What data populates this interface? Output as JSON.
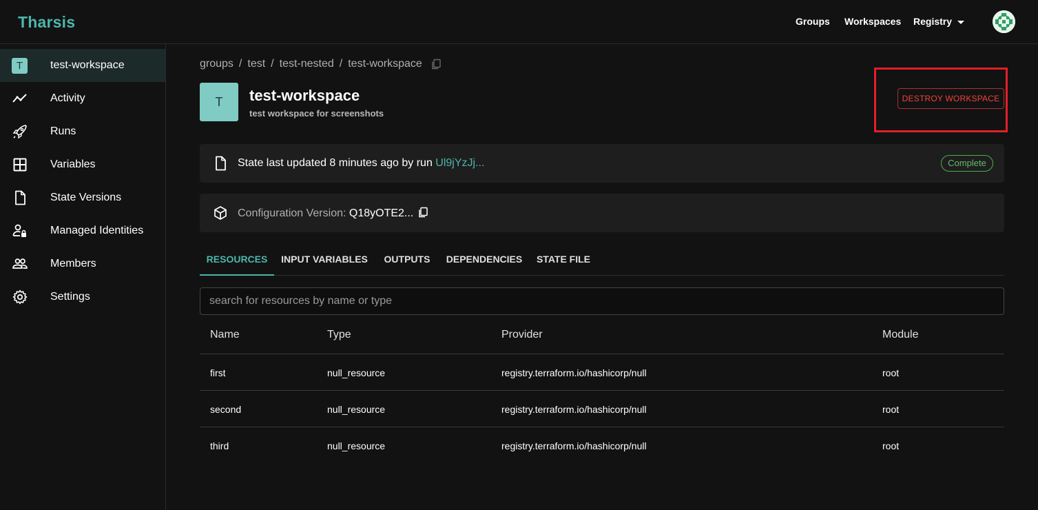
{
  "app": {
    "brand": "Tharsis"
  },
  "nav": {
    "groups": "Groups",
    "workspaces": "Workspaces",
    "registry": "Registry"
  },
  "sidebar": {
    "badge": "T",
    "items": [
      {
        "label": "test-workspace",
        "icon": "workspace-badge"
      },
      {
        "label": "Activity",
        "icon": "activity-icon"
      },
      {
        "label": "Runs",
        "icon": "rocket-icon"
      },
      {
        "label": "Variables",
        "icon": "grid-icon"
      },
      {
        "label": "State Versions",
        "icon": "file-icon"
      },
      {
        "label": "Managed Identities",
        "icon": "person-lock-icon"
      },
      {
        "label": "Members",
        "icon": "people-icon"
      },
      {
        "label": "Settings",
        "icon": "gear-icon"
      }
    ]
  },
  "breadcrumb": [
    "groups",
    "test",
    "test-nested",
    "test-workspace"
  ],
  "workspace": {
    "initial": "T",
    "name": "test-workspace",
    "description": "test workspace for screenshots",
    "destroy_label": "DESTROY WORKSPACE"
  },
  "state_card": {
    "text": "State last updated 8 minutes ago by run ",
    "run_link": "Ul9jYzJj...",
    "status": "Complete"
  },
  "config_card": {
    "label": "Configuration Version: ",
    "value": "Q18yOTE2..."
  },
  "tabs": [
    "RESOURCES",
    "INPUT VARIABLES",
    "OUTPUTS",
    "DEPENDENCIES",
    "STATE FILE"
  ],
  "search": {
    "placeholder": "search for resources by name or type"
  },
  "table": {
    "headers": [
      "Name",
      "Type",
      "Provider",
      "Module"
    ],
    "rows": [
      [
        "first",
        "null_resource",
        "registry.terraform.io/hashicorp/null",
        "root"
      ],
      [
        "second",
        "null_resource",
        "registry.terraform.io/hashicorp/null",
        "root"
      ],
      [
        "third",
        "null_resource",
        "registry.terraform.io/hashicorp/null",
        "root"
      ]
    ]
  },
  "colors": {
    "accent": "#4db6ac",
    "danger": "#f44336",
    "success": "#66bb6a",
    "highlight": "#e21f2b"
  }
}
